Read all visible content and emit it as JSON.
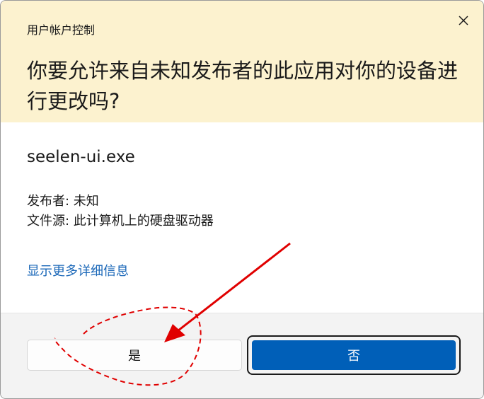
{
  "dialog": {
    "app_title": "用户帐户控制",
    "question": "你要允许来自未知发布者的此应用对你的设备进行更改吗?",
    "filename": "seelen-ui.exe",
    "publisher_line": "发布者: 未知",
    "source_line": "文件源: 此计算机上的硬盘驱动器",
    "more_details": "显示更多详细信息",
    "yes_label": "是",
    "no_label": "否"
  },
  "colors": {
    "header_bg": "#fcf2cf",
    "link": "#1a67b8",
    "primary_button": "#005fb8",
    "annotation": "#e00000"
  },
  "icons": {
    "close": "close-icon"
  }
}
